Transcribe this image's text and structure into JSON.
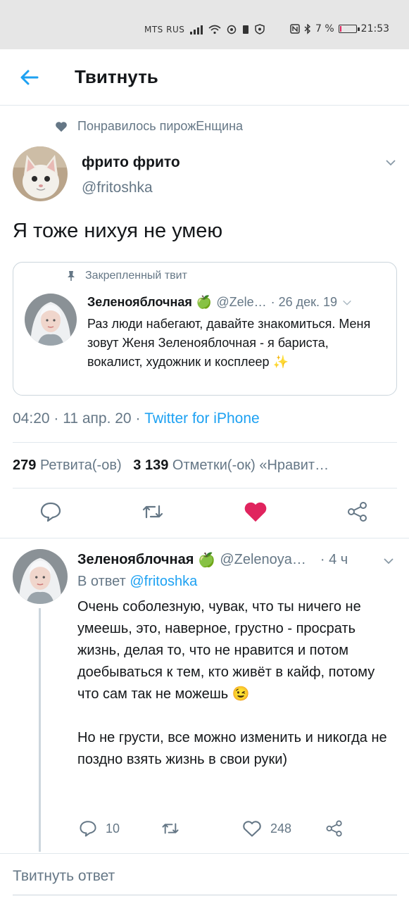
{
  "status_bar": {
    "carrier": "MTS RUS",
    "battery_percent": "7 %",
    "battery_level": 0.07,
    "time": "21:53"
  },
  "header": {
    "title": "Твитнуть"
  },
  "liked_by": "Понравилось пирожЕнщина",
  "tweet": {
    "author_name": "фрито фрито",
    "author_handle": "@fritoshka",
    "text": "Я тоже нихуя не умею",
    "timestamp": "04:20 · 11 апр. 20 · ",
    "source": "Twitter for iPhone",
    "retweets_count": "279",
    "retweets_label": "Ретвита(-ов)",
    "likes_count": "3 139",
    "likes_label": "Отметки(-ок) «Нравит…"
  },
  "quoted_tweet": {
    "pinned_label": "Закрепленный твит",
    "author_name": "Зеленояблочная",
    "author_emoji": "🍏",
    "handle": "@Zele…",
    "date": "· 26 дек. 19",
    "text": "Раз люди набегают, давайте знакомиться. Меня зовут Женя Зеленояблочная - я бариста, вокалист, художник и косплеер ✨"
  },
  "reply": {
    "author_name": "Зеленояблочная",
    "author_emoji": "🍏",
    "handle": "@Zelenoya…",
    "time": "· 4 ч",
    "reply_to_prefix": "В ответ ",
    "reply_to_handle": "@fritoshka",
    "paragraph_1": "Очень соболезную, чувак, что ты ничего не умеешь, это, наверное, грустно - просрать жизнь, делая то, что не нравится и потом доебываться к тем, кто живёт в кайф, потому что сам так не можешь 😉",
    "paragraph_2": "Но не грусти, все можно изменить и никогда не поздно взять жизнь в свои руки)",
    "reply_count": "10",
    "like_count": "248"
  },
  "compose_placeholder": "Твитнуть ответ",
  "colors": {
    "accent": "#1da1f2",
    "like": "#e0245e",
    "secondary_text": "#657786",
    "divider": "#e1e8ed"
  },
  "icons": [
    "back-arrow-icon",
    "heart-icon",
    "chevron-down-icon",
    "pin-icon",
    "reply-icon",
    "retweet-icon",
    "share-icon"
  ]
}
